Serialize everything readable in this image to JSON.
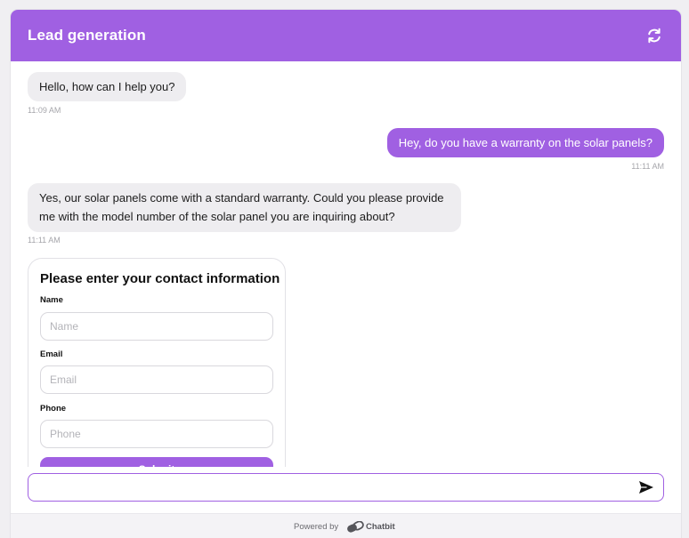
{
  "header": {
    "title": "Lead generation",
    "refresh_icon": "refresh-icon",
    "accent_color": "#a060e2"
  },
  "messages": [
    {
      "role": "bot",
      "text": "Hello, how can I help you?",
      "time": "11:09 AM"
    },
    {
      "role": "user",
      "text": "Hey, do you have a warranty on the solar panels?",
      "time": "11:11 AM"
    },
    {
      "role": "bot",
      "text": "Yes, our solar panels come with a standard warranty. Could you please provide me with the model number of the solar panel you are inquiring about?",
      "time": "11:11 AM"
    }
  ],
  "contact_form": {
    "title": "Please enter your contact information",
    "fields": [
      {
        "label": "Name",
        "placeholder": "Name",
        "value": ""
      },
      {
        "label": "Email",
        "placeholder": "Email",
        "value": ""
      },
      {
        "label": "Phone",
        "placeholder": "Phone",
        "value": ""
      }
    ],
    "submit_label": "Submit"
  },
  "composer": {
    "value": "",
    "send_icon": "send-icon"
  },
  "footer": {
    "powered_by": "Powered by",
    "brand": "Chatbit",
    "brand_icon": "chatbit-logo-icon"
  }
}
